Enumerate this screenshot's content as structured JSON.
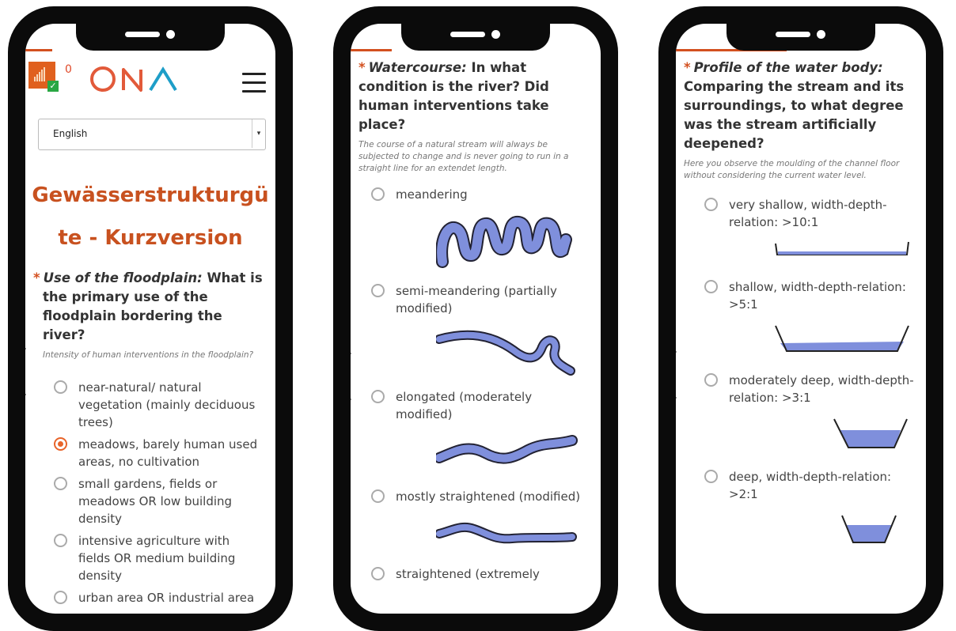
{
  "colors": {
    "accent": "#d3501f",
    "radio_selected": "#e8642a",
    "water": "#7f8fdc"
  },
  "phone1": {
    "notification_count": "0",
    "logo_text": "ONA",
    "language": {
      "selected": "English"
    },
    "survey_title_line1": "Gewässerstrukturgü",
    "survey_title_line2": "te - Kurzversion",
    "question": {
      "required_marker": "*",
      "lead": "Use of the floodplain:",
      "text": "What is the primary use of the floodplain bordering the river?",
      "help": "Intensity of human interventions in the floodplain?",
      "options": [
        {
          "label": "near-natural/ natural vegetation (mainly deciduous trees)",
          "selected": false
        },
        {
          "label": "meadows, barely human used areas, no cultivation",
          "selected": true
        },
        {
          "label": "small gardens, fields or meadows OR low building density",
          "selected": false
        },
        {
          "label": "intensive agriculture with fields OR medium building density",
          "selected": false
        },
        {
          "label": "urban area OR industrial area",
          "selected": false
        }
      ]
    }
  },
  "phone2": {
    "question": {
      "required_marker": "*",
      "lead": "Watercourse:",
      "text": "In what condition is the river? Did human interventions take place?",
      "help": "The course of a natural stream will always be subjected to change and is never going to run in a straight line for an extendet length.",
      "options": [
        {
          "label": "meandering",
          "image": "meandering-river-icon"
        },
        {
          "label": "semi-meandering (partially modified)",
          "image": "semi-meandering-river-icon"
        },
        {
          "label": "elongated (moderately modified)",
          "image": "elongated-river-icon"
        },
        {
          "label": "mostly straightened (modified)",
          "image": "mostly-straightened-river-icon"
        },
        {
          "label": "straightened (extremely",
          "image": ""
        }
      ]
    }
  },
  "phone3": {
    "question": {
      "required_marker": "*",
      "lead": "Profile of the water body:",
      "text": "Comparing the stream and its surroundings, to what degree was the stream artificially deepened?",
      "help": "Here you observe the moulding of the channel floor without considering the current water level.",
      "options": [
        {
          "label": "very shallow, width-depth-relation: >10:1",
          "image": "very-shallow-profile-icon"
        },
        {
          "label": "shallow, width-depth-relation: >5:1",
          "image": "shallow-profile-icon"
        },
        {
          "label": "moderately deep, width-depth-relation: >3:1",
          "image": "moderately-deep-profile-icon"
        },
        {
          "label": "deep, width-depth-relation: >2:1",
          "image": "deep-profile-icon"
        }
      ]
    }
  }
}
